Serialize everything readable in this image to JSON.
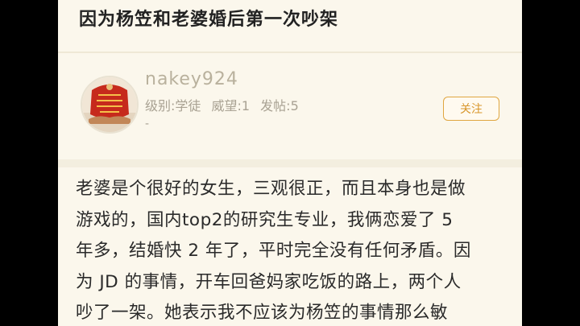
{
  "post": {
    "title": "因为杨笠和老婆婚后第一次吵架"
  },
  "author": {
    "username": "nakey924",
    "level": "级别:学徒",
    "prestige": "威望:1",
    "posts": "发帖:5",
    "dash": "-",
    "follow_label": "关注",
    "avatar_icon": "avatar-image"
  },
  "content": {
    "lines": [
      "老婆是个很好的女生，三观很正，而且本身也是做",
      "游戏的，国内top2的研究生专业，我俩恋爱了 5",
      "年多，结婚快 2 年了，平时完全没有任何矛盾。因",
      "为 JD 的事情，开车回爸妈家吃饭的路上，两个人",
      "吵了一架。她表示我不应该为杨笠的事情那么敏"
    ]
  },
  "colors": {
    "background": "#fbf7ec",
    "accent": "#e0a640",
    "username": "#b9b19d",
    "text": "#2a2a2a"
  }
}
